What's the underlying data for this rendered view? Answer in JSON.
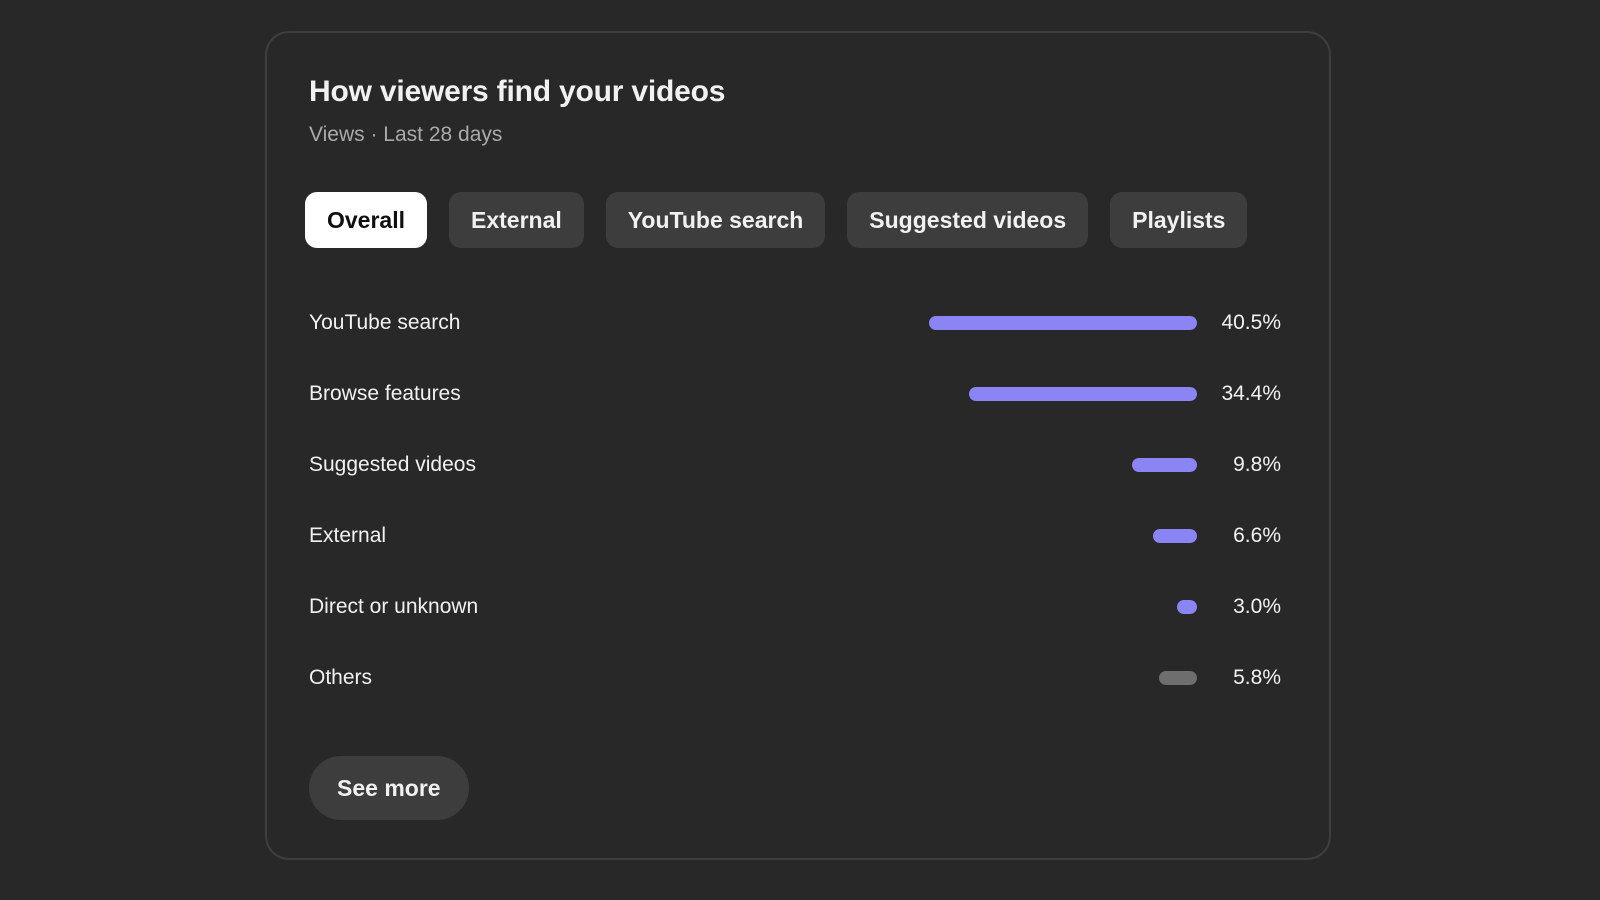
{
  "card": {
    "title": "How viewers find your videos",
    "subtitle": "Views · Last 28 days"
  },
  "tabs": [
    {
      "label": "Overall",
      "active": true
    },
    {
      "label": "External",
      "active": false
    },
    {
      "label": "YouTube search",
      "active": false
    },
    {
      "label": "Suggested videos",
      "active": false
    },
    {
      "label": "Playlists",
      "active": false
    }
  ],
  "sources": [
    {
      "label": "YouTube search",
      "value": "40.5%",
      "percent": 40.5,
      "color": "#8b84f5"
    },
    {
      "label": "Browse features",
      "value": "34.4%",
      "percent": 34.4,
      "color": "#8b84f5"
    },
    {
      "label": "Suggested videos",
      "value": "9.8%",
      "percent": 9.8,
      "color": "#8b84f5"
    },
    {
      "label": "External",
      "value": "6.6%",
      "percent": 6.6,
      "color": "#8b84f5"
    },
    {
      "label": "Direct or unknown",
      "value": "3.0%",
      "percent": 3.0,
      "color": "#8b84f5"
    },
    {
      "label": "Others",
      "value": "5.8%",
      "percent": 5.8,
      "color": "#6e6e6e"
    }
  ],
  "footer": {
    "see_more_label": "See more"
  },
  "colors": {
    "background": "#282828",
    "accent": "#8b84f5",
    "others": "#6e6e6e"
  }
}
